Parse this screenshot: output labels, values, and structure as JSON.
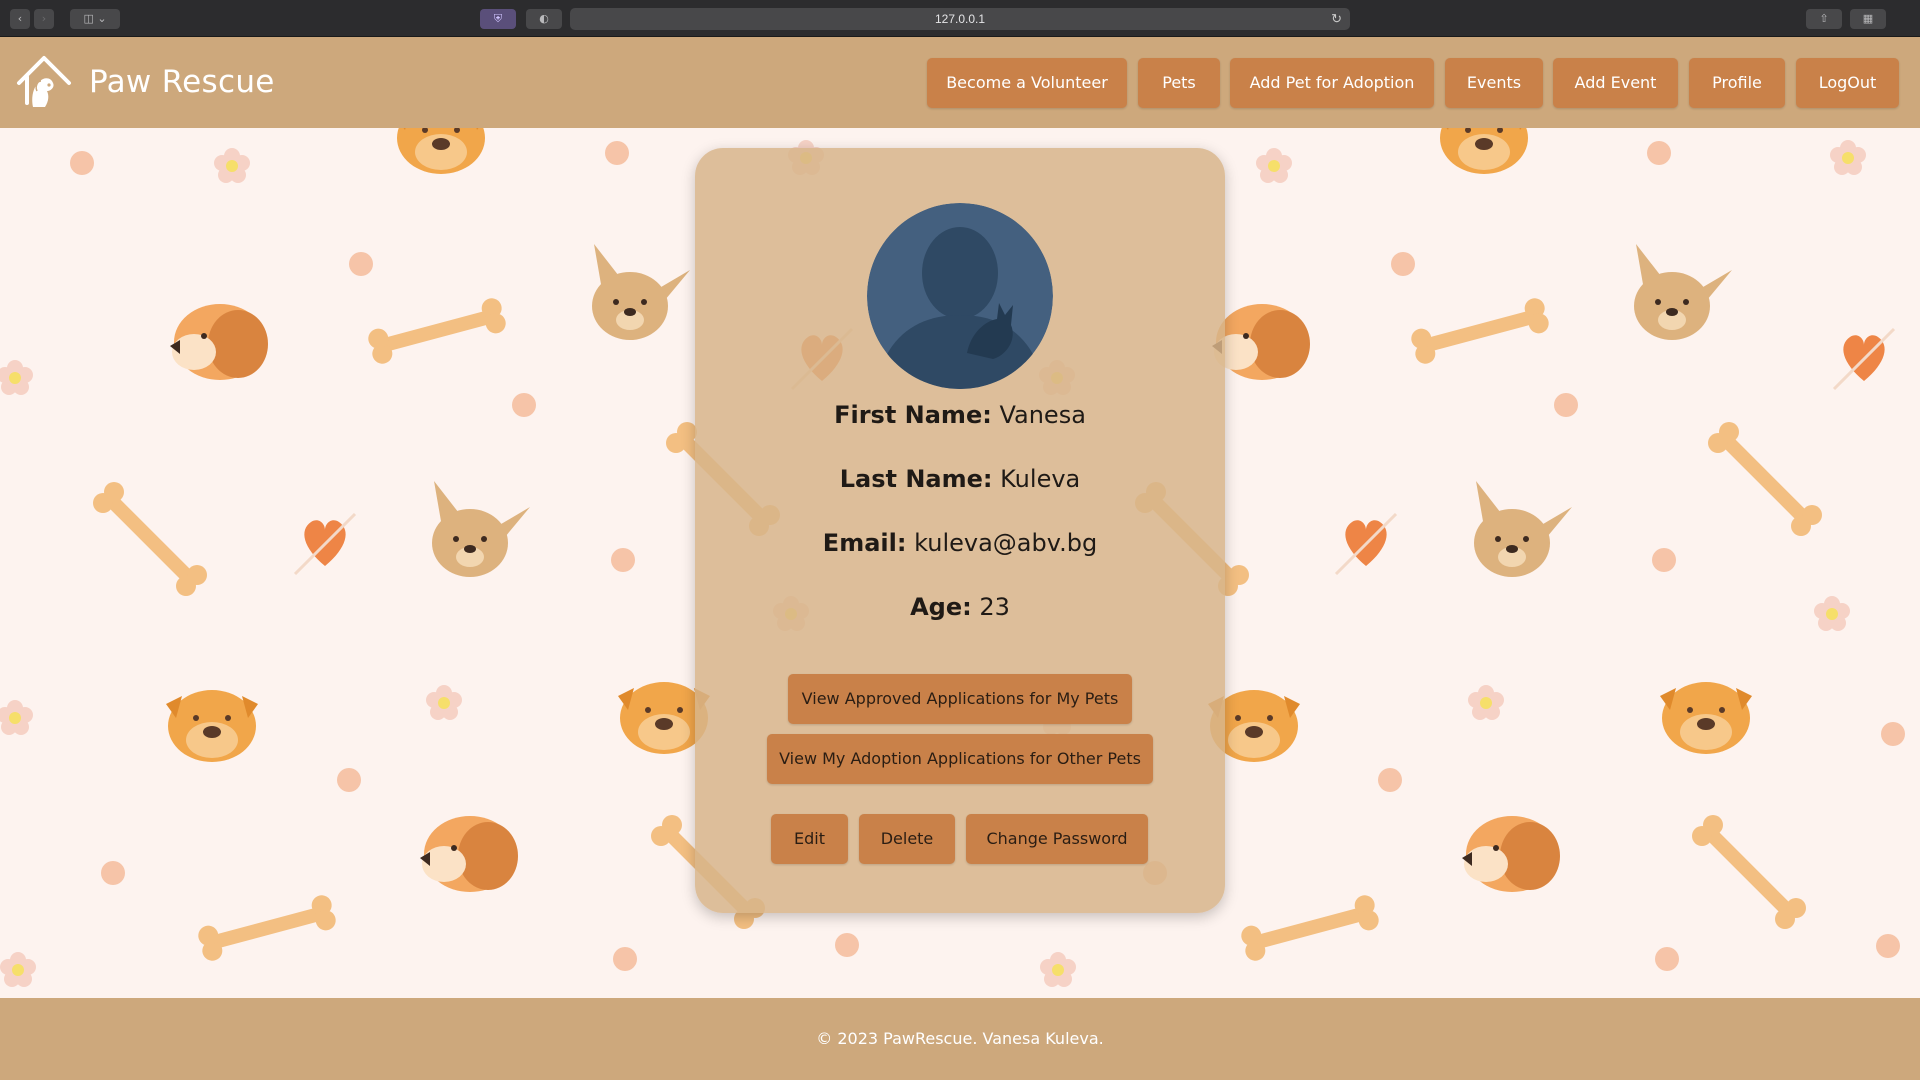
{
  "browser": {
    "url": "127.0.0.1"
  },
  "navbar": {
    "brand": "Paw Rescue",
    "items": [
      {
        "label": "Become a Volunteer"
      },
      {
        "label": "Pets"
      },
      {
        "label": "Add Pet for Adoption"
      },
      {
        "label": "Events"
      },
      {
        "label": "Add Event"
      },
      {
        "label": "Profile"
      },
      {
        "label": "LogOut"
      }
    ]
  },
  "profile": {
    "first_name_label": "First Name:",
    "first_name": "Vanesa",
    "last_name_label": "Last Name:",
    "last_name": "Kuleva",
    "email_label": "Email:",
    "email": "kuleva@abv.bg",
    "age_label": "Age:",
    "age": "23",
    "buttons": {
      "approved_apps": "View Approved Applications for My Pets",
      "my_apps": "View My Adoption Applications for Other Pets",
      "edit": "Edit",
      "delete": "Delete",
      "change_password": "Change Password"
    }
  },
  "footer": {
    "text": "© 2023 PawRescue. Vanesa Kuleva."
  },
  "colors": {
    "navbar_bg": "#cda87c",
    "button_bg": "#c98149",
    "page_bg": "#fdf3ef",
    "card_bg": "#d6b489",
    "avatar_bg": "#44607f"
  }
}
